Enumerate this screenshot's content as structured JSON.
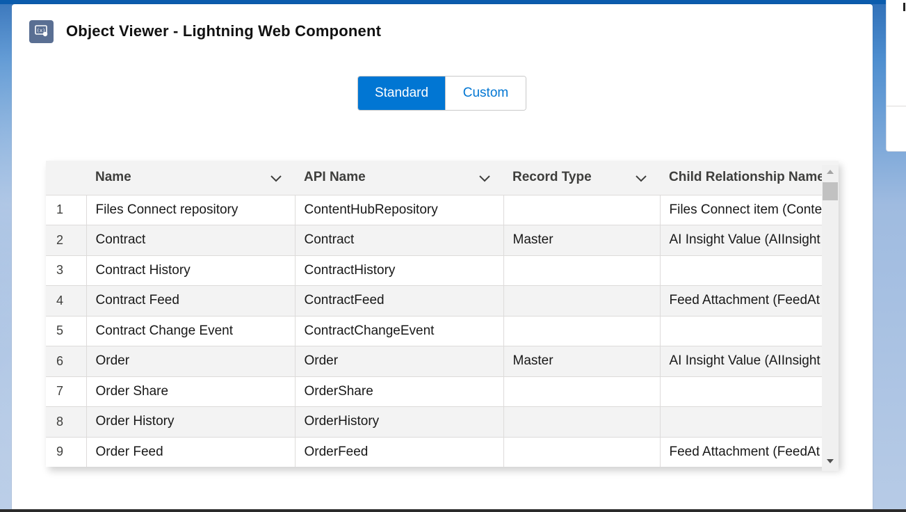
{
  "header": {
    "icon": "variable-code-icon",
    "title": "Object Viewer - Lightning Web Component"
  },
  "toggle": {
    "standard_label": "Standard",
    "custom_label": "Custom",
    "selected": "Standard"
  },
  "table": {
    "columns": [
      "Name",
      "API Name",
      "Record Type",
      "Child Relationship Name"
    ],
    "rows": [
      {
        "num": "1",
        "name": "Files Connect repository",
        "api": "ContentHubRepository",
        "rtype": "",
        "child": "Files Connect item (Conte"
      },
      {
        "num": "2",
        "name": "Contract",
        "api": "Contract",
        "rtype": "Master",
        "child": "AI Insight Value (AIInsight"
      },
      {
        "num": "3",
        "name": "Contract History",
        "api": "ContractHistory",
        "rtype": "",
        "child": ""
      },
      {
        "num": "4",
        "name": "Contract Feed",
        "api": "ContractFeed",
        "rtype": "",
        "child": "Feed Attachment (FeedAt"
      },
      {
        "num": "5",
        "name": "Contract Change Event",
        "api": "ContractChangeEvent",
        "rtype": "",
        "child": ""
      },
      {
        "num": "6",
        "name": "Order",
        "api": "Order",
        "rtype": "Master",
        "child": "AI Insight Value (AIInsight"
      },
      {
        "num": "7",
        "name": "Order Share",
        "api": "OrderShare",
        "rtype": "",
        "child": ""
      },
      {
        "num": "8",
        "name": "Order History",
        "api": "OrderHistory",
        "rtype": "",
        "child": ""
      },
      {
        "num": "9",
        "name": "Order Feed",
        "api": "OrderFeed",
        "rtype": "",
        "child": "Feed Attachment (FeedAt"
      }
    ]
  },
  "colors": {
    "brand": "#0176d3",
    "header_icon_bg": "#5a6f93",
    "row_alt": "#f3f3f3"
  }
}
